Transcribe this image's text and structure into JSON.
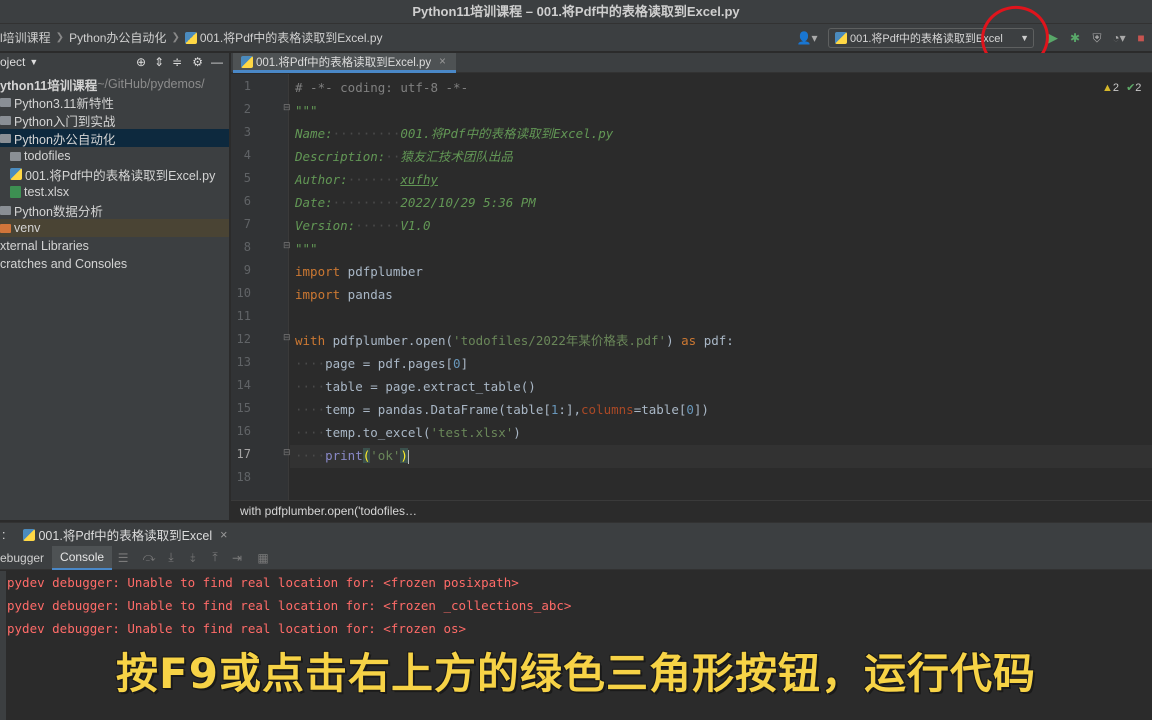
{
  "window": {
    "title": "Python11培训课程 – 001.将Pdf中的表格读取到Excel.py"
  },
  "breadcrumb": [
    "l培训课程",
    "Python办公自动化",
    "001.将Pdf中的表格读取到Excel.py"
  ],
  "run_config": {
    "label": "001.将Pdf中的表格读取到Excel"
  },
  "sidebar": {
    "header": "oject",
    "items": [
      {
        "label": "ython11培训课程",
        "suffix": " ~/GitHub/pydemos/"
      },
      {
        "label": "Python3.11新特性"
      },
      {
        "label": "Python入门到实战"
      },
      {
        "label": "Python办公自动化"
      },
      {
        "label": "todofiles"
      },
      {
        "label": "001.将Pdf中的表格读取到Excel.py"
      },
      {
        "label": "test.xlsx"
      },
      {
        "label": "Python数据分析"
      },
      {
        "label": "venv"
      },
      {
        "label": "xternal Libraries"
      },
      {
        "label": "cratches and Consoles"
      }
    ]
  },
  "editor": {
    "tab_label": "001.将Pdf中的表格读取到Excel.py",
    "warnings": {
      "warn_count": "2",
      "ok_count": "2"
    },
    "line_numbers": [
      "1",
      "2",
      "3",
      "4",
      "5",
      "6",
      "7",
      "8",
      "9",
      "10",
      "11",
      "12",
      "13",
      "14",
      "15",
      "16",
      "17",
      "18"
    ],
    "current_line": "17",
    "code": {
      "l1": "# -*- coding: utf-8 -*-",
      "l2": "\"\"\"",
      "l3_key": "Name:",
      "l3_val": "001.将Pdf中的表格读取到Excel.py",
      "l4_key": "Description:",
      "l4_val": "猿友汇技术团队出品",
      "l5_key": "Author:",
      "l5_val": "xufhy",
      "l6_key": "Date:",
      "l6_val": "2022/10/29 5:36 PM",
      "l7_key": "Version:",
      "l7_val": "V1.0",
      "l8": "\"\"\"",
      "l9_kw": "import",
      "l9_mod": " pdfplumber",
      "l10_kw": "import",
      "l10_mod": " pandas",
      "l12_kw": "with",
      "l12_a": " pdfplumber.open(",
      "l12_str": "'todofiles/2022年某价格表.pdf'",
      "l12_b": ") ",
      "l12_as": "as",
      "l12_c": " pdf:",
      "l13_a": "page = pdf.pages[",
      "l13_num": "0",
      "l13_b": "]",
      "l14": "table = page.extract_table()",
      "l15_a": "temp = pandas.DataFrame(table[",
      "l15_num": "1",
      "l15_b": ":],",
      "l15_param": "columns",
      "l15_c": "=table[",
      "l15_num2": "0",
      "l15_d": "])",
      "l16_a": "temp.to_excel(",
      "l16_str": "'test.xlsx'",
      "l16_b": ")",
      "l17_fn": "print",
      "l17_a": "(",
      "l17_str": "'ok'",
      "l17_b": ")"
    },
    "breadcrumb_hint": "with pdfplumber.open('todofiles…"
  },
  "debug": {
    "run_tab_label": "001.将Pdf中的表格读取到Excel",
    "prefix": ":",
    "tabs": [
      "ebugger",
      "Console"
    ],
    "console_lines": [
      "pydev debugger: Unable to find real location for: <frozen posixpath>",
      "pydev debugger: Unable to find real location for: <frozen _collections_abc>",
      "pydev debugger: Unable to find real location for: <frozen os>"
    ]
  },
  "caption": "按F9或点击右上方的绿色三角形按钮，运行代码",
  "colors": {
    "accent": "#4a88c7",
    "run_green": "#59a869",
    "stop_red": "#c75450",
    "annotation_red": "#e0141c",
    "caption_yellow": "#f7d346"
  },
  "icons": [
    "user-icon",
    "python-file-icon",
    "run-icon",
    "debug-icon",
    "coverage-icon",
    "profile-icon",
    "stop-icon",
    "globe-icon",
    "collapse-icon",
    "expand-icon",
    "gear-icon",
    "folder-icon",
    "excel-file-icon",
    "warning-icon",
    "check-icon",
    "close-icon"
  ]
}
